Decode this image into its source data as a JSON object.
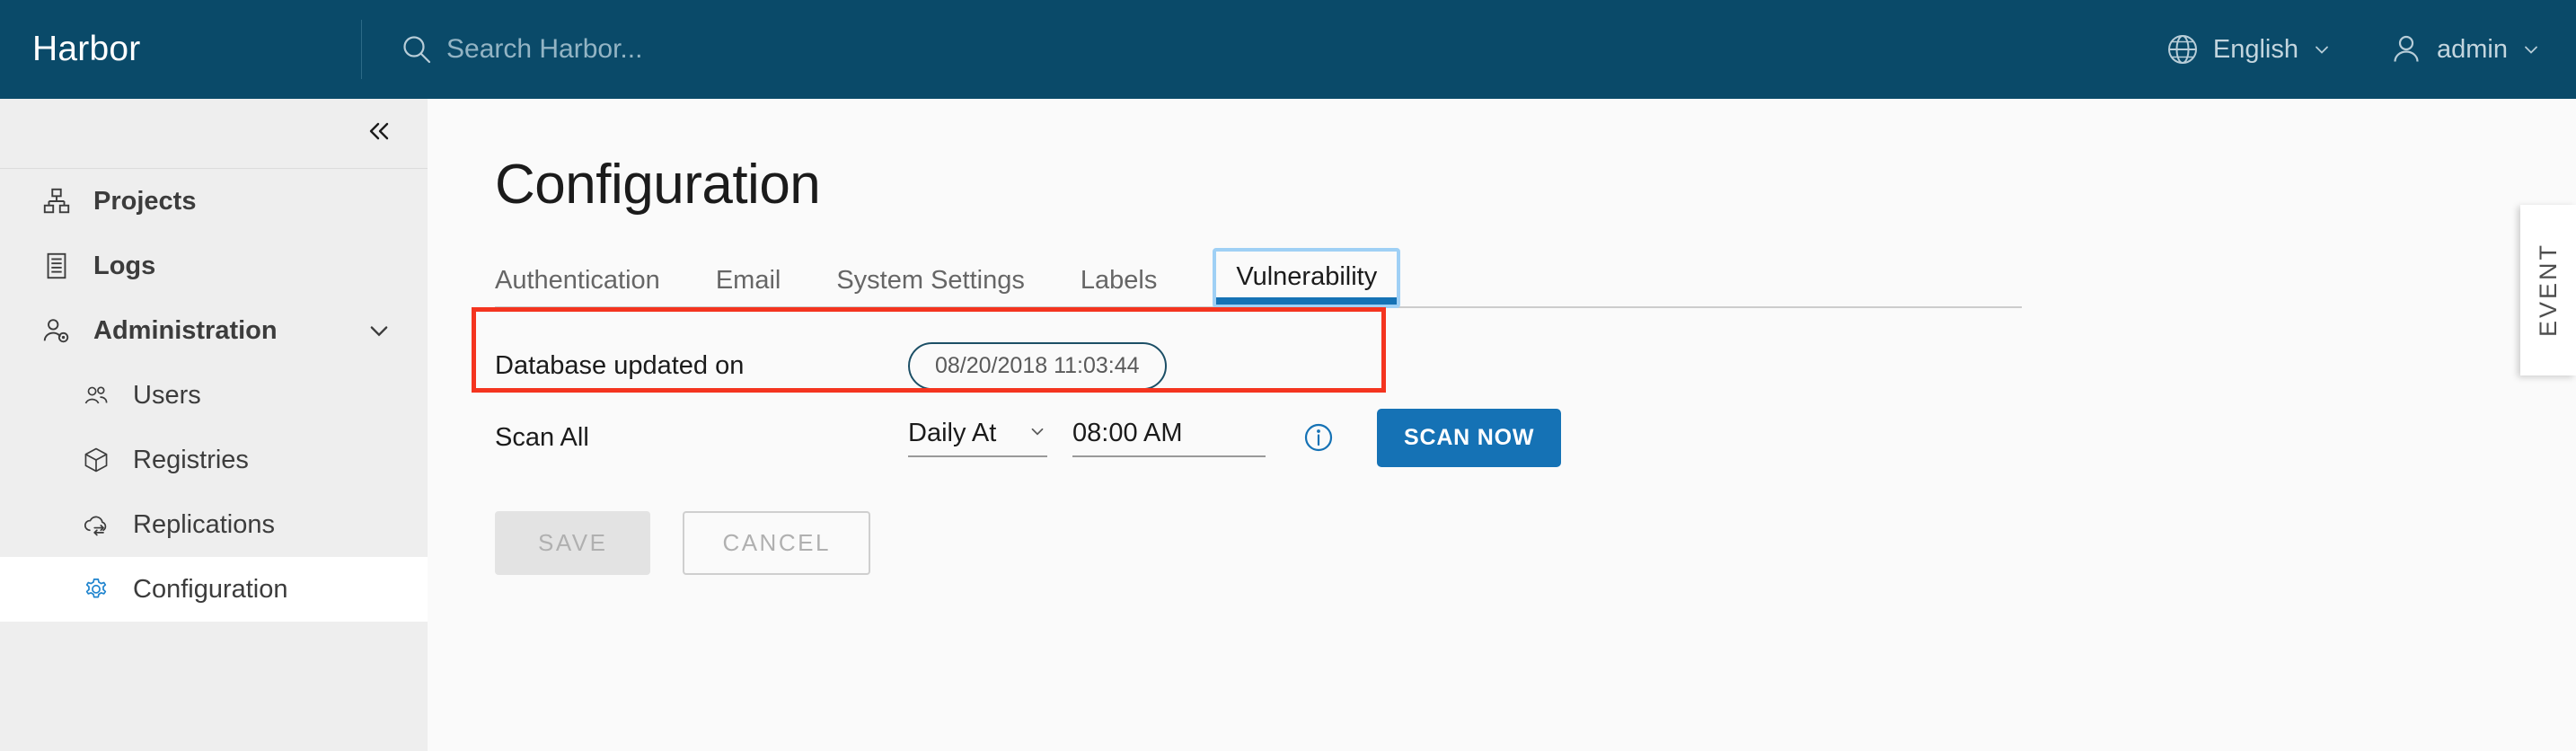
{
  "header": {
    "brand": "Harbor",
    "search": {
      "icon": "search-icon",
      "placeholder": "Search Harbor...",
      "value": ""
    },
    "language": {
      "icon": "globe-icon",
      "label": "English",
      "caret": "chevron-down-icon"
    },
    "account": {
      "icon": "user-icon",
      "label": "admin",
      "caret": "chevron-down-icon"
    }
  },
  "sidebar": {
    "collapse_icon": "double-chevron-left-icon",
    "items": [
      {
        "label": "Projects",
        "icon": "projects-icon",
        "level": "top",
        "selected": false,
        "expandable": false
      },
      {
        "label": "Logs",
        "icon": "logs-icon",
        "level": "top",
        "selected": false,
        "expandable": false
      },
      {
        "label": "Administration",
        "icon": "administration-icon",
        "level": "top",
        "selected": false,
        "expandable": true,
        "expand_icon": "chevron-down-icon"
      },
      {
        "label": "Users",
        "icon": "users-icon",
        "level": "sub",
        "selected": false,
        "expandable": false
      },
      {
        "label": "Registries",
        "icon": "registries-icon",
        "level": "sub",
        "selected": false,
        "expandable": false
      },
      {
        "label": "Replications",
        "icon": "replications-icon",
        "level": "sub",
        "selected": false,
        "expandable": false
      },
      {
        "label": "Configuration",
        "icon": "gear-icon",
        "level": "sub",
        "selected": true,
        "expandable": false
      }
    ]
  },
  "main": {
    "title": "Configuration",
    "tabs": [
      {
        "label": "Authentication",
        "active": false
      },
      {
        "label": "Email",
        "active": false
      },
      {
        "label": "System Settings",
        "active": false
      },
      {
        "label": "Labels",
        "active": false
      },
      {
        "label": "Vulnerability",
        "active": true
      }
    ],
    "database_row": {
      "label": "Database updated on",
      "value": "08/20/2018 11:03:44"
    },
    "scan_row": {
      "label": "Scan All",
      "schedule_value": "Daily At",
      "schedule_caret": "chevron-down-icon",
      "time_value": "08:00 AM",
      "info_icon": "info-circle-icon",
      "scan_button": "SCAN NOW"
    },
    "actions": {
      "save": "SAVE",
      "cancel": "CANCEL"
    }
  },
  "event_tab": {
    "label": "EVENT"
  },
  "colors": {
    "header_bg": "#0a4a69",
    "sidebar_bg": "#eeeeee",
    "content_bg": "#fafafa",
    "accent_blue": "#1572b5",
    "focus_ring": "#9fd0f5",
    "highlight_red": "#f4341f",
    "chip_border": "#1c4f66"
  }
}
